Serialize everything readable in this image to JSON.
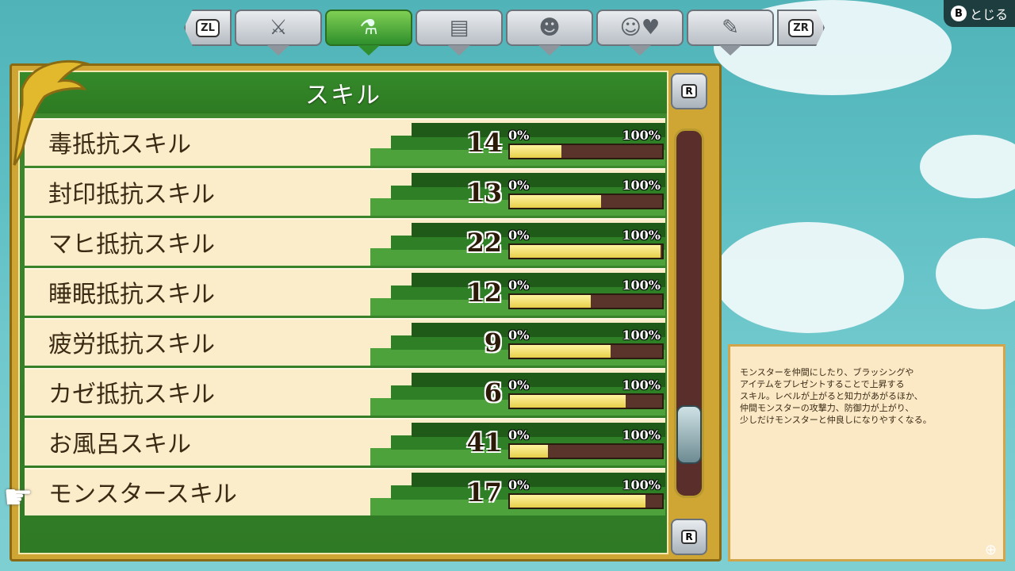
{
  "header": {
    "shoulder_left": "ZL",
    "shoulder_right": "ZR",
    "tabs": [
      {
        "icon": "sword-shield-icon",
        "glyph": "⚔"
      },
      {
        "icon": "flask-hammer-icon",
        "glyph": "⚗"
      },
      {
        "icon": "document-icon",
        "glyph": "▤"
      },
      {
        "icon": "monster-faces-icon",
        "glyph": "☻"
      },
      {
        "icon": "smile-heart-icon",
        "glyph": "☺♥"
      },
      {
        "icon": "wrench-icon",
        "glyph": "✎"
      }
    ],
    "close_button": "B",
    "close_label": "とじる"
  },
  "panel": {
    "title": "スキル",
    "percent_min": "0%",
    "percent_max": "100%",
    "scroll_top_button": "R",
    "scroll_bottom_button": "R"
  },
  "skills": [
    {
      "name": "毒抵抗スキル",
      "value": "14",
      "progress": 0.34
    },
    {
      "name": "封印抵抗スキル",
      "value": "13",
      "progress": 0.6
    },
    {
      "name": "マヒ抵抗スキル",
      "value": "22",
      "progress": 0.99
    },
    {
      "name": "睡眠抵抗スキル",
      "value": "12",
      "progress": 0.53
    },
    {
      "name": "疲労抵抗スキル",
      "value": "9",
      "progress": 0.66
    },
    {
      "name": "カゼ抵抗スキル",
      "value": "6",
      "progress": 0.76
    },
    {
      "name": "お風呂スキル",
      "value": "41",
      "progress": 0.25
    },
    {
      "name": "モンスタースキル",
      "value": "17",
      "progress": 0.89
    }
  ],
  "description": "モンスターを仲間にしたり、ブラッシングや\nアイテムをプレゼントすることで上昇する\nスキル。レベルが上がると知力があがるほか、\n仲間モンスターの攻撃力、防御力が上がり、\n少しだけモンスターと仲良しになりやすくなる。",
  "colors": {
    "panel_green": "#2f7a25",
    "frame_gold": "#cfa634",
    "bar_fill": "#e7cf4a",
    "bar_empty": "#5a332a"
  }
}
